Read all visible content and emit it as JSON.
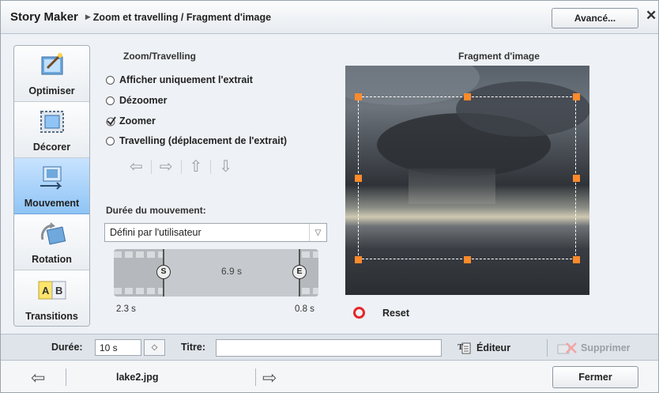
{
  "titlebar": {
    "app_title": "Story Maker",
    "breadcrumb": "Zoom et travelling / Fragment d'image",
    "advanced_label": "Avancé...",
    "close_symbol": "✕"
  },
  "tabs": [
    {
      "label": "Optimiser",
      "icon": "wand-image-icon",
      "active": false
    },
    {
      "label": "Décorer",
      "icon": "frame-icon",
      "active": false
    },
    {
      "label": "Mouvement",
      "icon": "motion-icon",
      "active": true
    },
    {
      "label": "Rotation",
      "icon": "rotation-icon",
      "active": false
    },
    {
      "label": "Transitions",
      "icon": "ab-transition-icon",
      "active": false
    }
  ],
  "zoom": {
    "heading": "Zoom/Travelling",
    "options": [
      {
        "label": "Afficher uniquement l'extrait",
        "selected": false
      },
      {
        "label": "Dézoomer",
        "selected": false
      },
      {
        "label": "Zoomer",
        "selected": true
      },
      {
        "label": "Travelling (déplacement de l'extrait)",
        "selected": false
      }
    ],
    "arrows": [
      "⇦",
      "⇨",
      "⇧",
      "⇩"
    ]
  },
  "motion": {
    "heading": "Durée du mouvement:",
    "dropdown_value": "Défini par l'utilisateur",
    "start_marker": "S",
    "end_marker": "E",
    "duration_label": "6.9 s",
    "start_time": "2.3 s",
    "end_time": "0.8 s"
  },
  "fragment": {
    "heading": "Fragment d'image",
    "reset_label": "Reset"
  },
  "toolbar": {
    "duration_label": "Durée:",
    "duration_value": "10 s",
    "title_label": "Titre:",
    "title_value": "",
    "editor_label": "Éditeur",
    "delete_label": "Supprimer"
  },
  "footer": {
    "filename": "lake2.jpg",
    "close_label": "Fermer"
  },
  "colors": {
    "active_tab": "#8fc4f5",
    "handle": "#ff8a2b",
    "reset": "#e3272b"
  }
}
